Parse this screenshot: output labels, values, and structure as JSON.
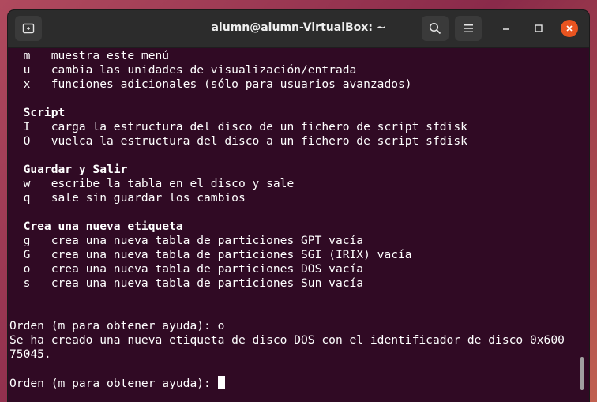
{
  "window": {
    "title": "alumn@alumn-VirtualBox: ~"
  },
  "toolbar": {
    "new_tab_icon": "new-tab-icon",
    "search_icon": "search-icon",
    "menu_icon": "hamburger-menu-icon"
  },
  "colors": {
    "terminal_bg": "#300a24",
    "titlebar_bg": "#2c2c2c",
    "close_accent": "#e95420"
  },
  "terminal": {
    "lines": [
      "  m   muestra este menú",
      "  u   cambia las unidades de visualización/entrada",
      "  x   funciones adicionales (sólo para usuarios avanzados)",
      "",
      "  Script",
      "  I   carga la estructura del disco de un fichero de script sfdisk",
      "  O   vuelca la estructura del disco a un fichero de script sfdisk",
      "",
      "  Guardar y Salir",
      "  w   escribe la tabla en el disco y sale",
      "  q   sale sin guardar los cambios",
      "",
      "  Crea una nueva etiqueta",
      "  g   crea una nueva tabla de particiones GPT vacía",
      "  G   crea una nueva tabla de particiones SGI (IRIX) vacía",
      "  o   crea una nueva tabla de particiones DOS vacía",
      "  s   crea una nueva tabla de particiones Sun vacía",
      "",
      "",
      "Orden (m para obtener ayuda): o",
      "Se ha creado una nueva etiqueta de disco DOS con el identificador de disco 0x600",
      "75045.",
      "",
      "Orden (m para obtener ayuda): "
    ]
  }
}
